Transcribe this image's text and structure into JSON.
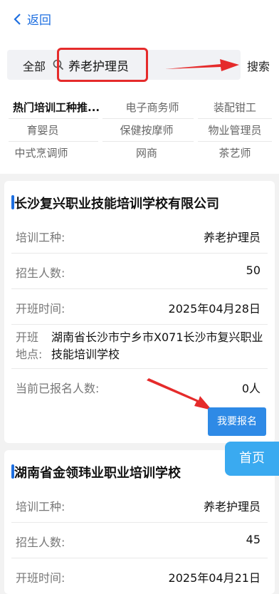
{
  "nav": {
    "back_label": "返回"
  },
  "search": {
    "scope": "全部",
    "query": "养老护理员",
    "button_label": "搜索"
  },
  "tags": {
    "hot_label": "热门培训工种推...",
    "items": [
      "电子商务师",
      "装配钳工",
      "育婴员",
      "保健按摩师",
      "物业管理员",
      "中式烹调师",
      "网商",
      "茶艺师"
    ]
  },
  "cards": [
    {
      "school": "长沙复兴职业技能培训学校有限公司",
      "rows": [
        {
          "label": "培训工种:",
          "value": "养老护理员"
        },
        {
          "label": "招生人数:",
          "value": "50"
        },
        {
          "label": "开班时间:",
          "value": "2025年04月28日"
        }
      ],
      "address_label": "开班地点:",
      "address_value": "湖南省长沙市宁乡市X071长沙市复兴职业技能培训学校",
      "enrolled_label": "当前已报名人数:",
      "enrolled_value": "0人",
      "enroll_button": "我要报名"
    },
    {
      "school": "湖南省金领玮业职业培训学校",
      "rows": [
        {
          "label": "培训工种:",
          "value": "养老护理员"
        },
        {
          "label": "招生人数:",
          "value": "45"
        },
        {
          "label": "开班时间:",
          "value": "2025年04月21日"
        }
      ]
    }
  ],
  "home_button": "首页",
  "colors": {
    "accent": "#1e6fe0",
    "annotation": "#e52b2b",
    "button": "#2e8ae6"
  }
}
